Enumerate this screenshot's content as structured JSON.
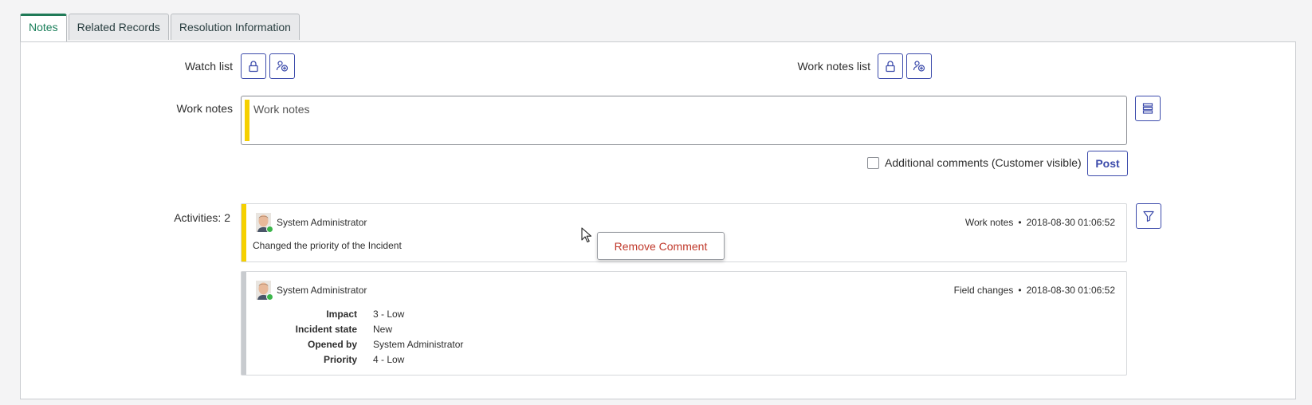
{
  "tabs": [
    {
      "label": "Notes",
      "active": true
    },
    {
      "label": "Related Records",
      "active": false
    },
    {
      "label": "Resolution Information",
      "active": false
    }
  ],
  "watch_list": {
    "label": "Watch list",
    "icons": [
      "lock-icon",
      "add-user-icon"
    ]
  },
  "work_notes_list": {
    "label": "Work notes list",
    "icons": [
      "lock-icon",
      "add-user-icon"
    ]
  },
  "work_notes": {
    "label": "Work notes",
    "placeholder": "Work notes",
    "accent_color": "#f5d000"
  },
  "additional_comments": {
    "label": "Additional comments (Customer visible)",
    "checked": false
  },
  "post_label": "Post",
  "activities": {
    "label": "Activities: 2",
    "entries": [
      {
        "author": "System Administrator",
        "type": "Work notes",
        "timestamp": "2018-08-30 01:06:52",
        "text": "Changed the priority of the Incident",
        "stripe_color": "#f5d000"
      },
      {
        "author": "System Administrator",
        "type": "Field changes",
        "timestamp": "2018-08-30 01:06:52",
        "stripe_color": "#c8cbcf",
        "fields": [
          {
            "key": "Impact",
            "value": "3 - Low"
          },
          {
            "key": "Incident state",
            "value": "New"
          },
          {
            "key": "Opened by",
            "value": "System Administrator"
          },
          {
            "key": "Priority",
            "value": "4 - Low"
          }
        ]
      }
    ]
  },
  "context_menu": {
    "label": "Remove Comment"
  },
  "colors": {
    "accent": "#3c4bab",
    "active_tab": "#1f7a57",
    "danger": "#c0392b",
    "online": "#3bb54a"
  }
}
